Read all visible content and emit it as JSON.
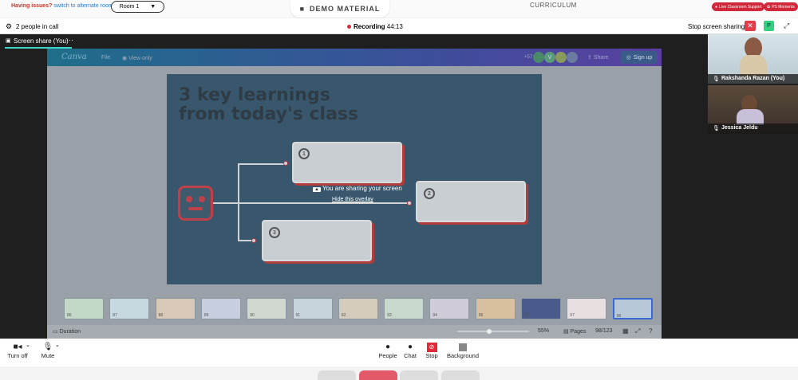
{
  "topbar": {
    "issues_text": "Having issues?",
    "alt_room_link": "switch to alternate room",
    "room_label": "Room 1",
    "demo_label": "DEMO MATERIAL",
    "curriculum_label": "CURRICULUM",
    "live_support": "Live Classroom Support",
    "ps_moments": "PS Moments"
  },
  "call": {
    "people_count": "2 people in call",
    "recording_label": "Recording",
    "recording_time": "44:13",
    "stop_sharing": "Stop screen sharing",
    "avatar_letter": "P"
  },
  "stage": {
    "tab_label": "Screen share (You)",
    "tab_more": "···",
    "overlay_message": "You are sharing your screen",
    "overlay_hide": "Hide this overlay"
  },
  "canva": {
    "logo": "Canva",
    "file_menu": "File",
    "view_only": "View only",
    "share": "Share",
    "sign_up": "Sign up",
    "plus_count": "+57",
    "duration": "Duration",
    "zoom": "55%",
    "pages_label": "Pages",
    "pages_value": "98/123",
    "thumb_numbers": [
      "86",
      "87",
      "88",
      "89",
      "90",
      "91",
      "92",
      "93",
      "94",
      "95",
      "96",
      "97",
      "98"
    ]
  },
  "slide": {
    "title_line1": "3 key learnings",
    "title_line2": "from today's class",
    "numbers": [
      "1",
      "2",
      "3"
    ]
  },
  "participants": [
    {
      "name": "Rakshanda Razan (You)"
    },
    {
      "name": "Jessica Jeldu"
    }
  ],
  "toolbar": {
    "turn_off": "Turn off",
    "mute": "Mute",
    "people": "People",
    "chat": "Chat",
    "stop": "Stop",
    "background": "Background"
  },
  "colors": {
    "accent_red": "#e02a3a",
    "accent_teal": "#3fd3c3",
    "slide_bg": "#38576c"
  }
}
